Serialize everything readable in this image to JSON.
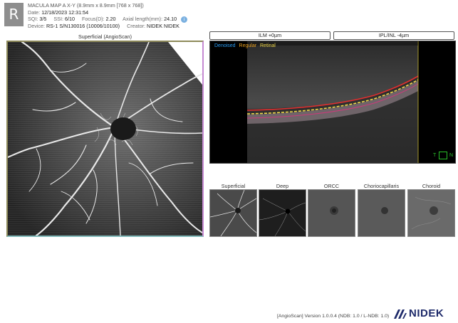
{
  "header": {
    "eye": "R",
    "scan_title": "MACULA MAP A X-Y (8.9mm x 8.9mm [768 x 768])",
    "date_label": "Date:",
    "date_value": "12/18/2023 12:31:54",
    "sqi_label": "SQI:",
    "sqi_value": "3/5",
    "ssi_label": "SSI:",
    "ssi_value": "6/10",
    "focus_label": "Focus(D):",
    "focus_value": "2.20",
    "axial_label": "Axial length(mm):",
    "axial_value": "24.10",
    "info_glyph": "i",
    "device_label": "Device:",
    "device_value": "RS-1 S/N130016 (10006/10100)",
    "creator_label": "Creator:",
    "creator_value": "NIDEK NIDEK"
  },
  "main_view": {
    "title": "Superficial (AngioScan)"
  },
  "bscan": {
    "slab_top": "ILM +0µm",
    "slab_bottom": "IPL/INL -4µm",
    "legend": [
      {
        "label": "Denoised",
        "color": "#2a9df4"
      },
      {
        "label": "Regular",
        "color": "#e8a020"
      },
      {
        "label": "Retinal",
        "color": "#f0d84a"
      }
    ],
    "orient_t": "T",
    "orient_n": "N"
  },
  "thumbnails": [
    {
      "label": "Superficial"
    },
    {
      "label": "Deep"
    },
    {
      "label": "ORCC"
    },
    {
      "label": "Choriocapillaris"
    },
    {
      "label": "Choroid"
    }
  ],
  "footer": {
    "product": "[AngioScan]",
    "version": "Version 1.0.0.4 (NDB: 1.0 / L-NDB: 1.0)",
    "brand": "NIDEK"
  },
  "colors": {
    "frame_top": "#8e8a5a",
    "frame_right": "#c68ad2",
    "frame_bottom": "#7fb8b8",
    "brand": "#1e2a6a",
    "orient": "#29c029"
  }
}
